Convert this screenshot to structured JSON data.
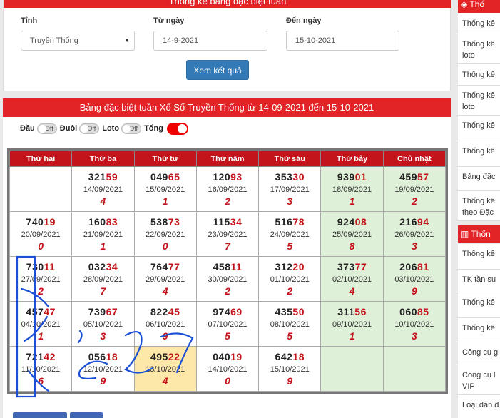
{
  "search": {
    "header": "Thống kê bảng đặc biệt tuần",
    "province_label": "Tỉnh",
    "province_value": "Truyền Thống",
    "from_label": "Từ ngày",
    "from_value": "14-9-2021",
    "to_label": "Đến ngày",
    "to_value": "15-10-2021",
    "submit_label": "Xem kết quả"
  },
  "main": {
    "title": "Bảng đặc biệt tuần Xổ Số Truyền Thống từ 14-09-2021 đến 15-10-2021",
    "toggles": {
      "dau": "Đầu",
      "duoi": "Đuôi",
      "loto": "Loto",
      "tong": "Tổng",
      "off_text": "Off"
    },
    "columns": [
      "Thứ hai",
      "Thứ ba",
      "Thứ tư",
      "Thứ năm",
      "Thứ sáu",
      "Thứ bảy",
      "Chủ nhật"
    ],
    "rows": [
      [
        null,
        {
          "head": "321",
          "tail": "59",
          "date": "14/09/2021",
          "total": "4"
        },
        {
          "head": "049",
          "tail": "65",
          "date": "15/09/2021",
          "total": "1"
        },
        {
          "head": "120",
          "tail": "93",
          "date": "16/09/2021",
          "total": "2"
        },
        {
          "head": "353",
          "tail": "30",
          "date": "17/09/2021",
          "total": "3"
        },
        {
          "head": "939",
          "tail": "01",
          "date": "18/09/2021",
          "total": "1"
        },
        {
          "head": "459",
          "tail": "57",
          "date": "19/09/2021",
          "total": "2"
        }
      ],
      [
        {
          "head": "740",
          "tail": "19",
          "date": "20/09/2021",
          "total": "0"
        },
        {
          "head": "160",
          "tail": "83",
          "date": "21/09/2021",
          "total": "1"
        },
        {
          "head": "538",
          "tail": "73",
          "date": "22/09/2021",
          "total": "0"
        },
        {
          "head": "115",
          "tail": "34",
          "date": "23/09/2021",
          "total": "7"
        },
        {
          "head": "516",
          "tail": "78",
          "date": "24/09/2021",
          "total": "5"
        },
        {
          "head": "924",
          "tail": "08",
          "date": "25/09/2021",
          "total": "8"
        },
        {
          "head": "216",
          "tail": "94",
          "date": "26/09/2021",
          "total": "3"
        }
      ],
      [
        {
          "head": "730",
          "tail": "11",
          "date": "27/09/2021",
          "total": "2"
        },
        {
          "head": "032",
          "tail": "34",
          "date": "28/09/2021",
          "total": "7"
        },
        {
          "head": "764",
          "tail": "77",
          "date": "29/09/2021",
          "total": "4"
        },
        {
          "head": "458",
          "tail": "11",
          "date": "30/09/2021",
          "total": "2"
        },
        {
          "head": "312",
          "tail": "20",
          "date": "01/10/2021",
          "total": "2"
        },
        {
          "head": "373",
          "tail": "77",
          "date": "02/10/2021",
          "total": "4"
        },
        {
          "head": "206",
          "tail": "81",
          "date": "03/10/2021",
          "total": "9"
        }
      ],
      [
        {
          "head": "457",
          "tail": "47",
          "date": "04/10/2021",
          "total": "1"
        },
        {
          "head": "739",
          "tail": "67",
          "date": "05/10/2021",
          "total": "3"
        },
        {
          "head": "822",
          "tail": "45",
          "date": "06/10/2021",
          "total": "9"
        },
        {
          "head": "974",
          "tail": "69",
          "date": "07/10/2021",
          "total": "5"
        },
        {
          "head": "435",
          "tail": "50",
          "date": "08/10/2021",
          "total": "5"
        },
        {
          "head": "311",
          "tail": "56",
          "date": "09/10/2021",
          "total": "1"
        },
        {
          "head": "060",
          "tail": "85",
          "date": "10/10/2021",
          "total": "3"
        }
      ],
      [
        {
          "head": "721",
          "tail": "42",
          "date": "11/10/2021",
          "total": "6"
        },
        {
          "head": "056",
          "tail": "18",
          "date": "12/10/2021",
          "total": "9"
        },
        {
          "head": "495",
          "tail": "22",
          "date": "13/10/2021",
          "total": "4",
          "highlight": true
        },
        {
          "head": "040",
          "tail": "19",
          "date": "14/10/2021",
          "total": "0"
        },
        {
          "head": "642",
          "tail": "18",
          "date": "15/10/2021",
          "total": "9"
        },
        null,
        null
      ]
    ]
  },
  "sidebar": {
    "header1": "Thố",
    "items1": [
      "Thống kê",
      "Thống kê loto",
      "Thống kê",
      "Thống kê loto",
      "Thống kê",
      "Thống kê",
      "Bảng đặc",
      "Thống kê theo Đặc"
    ],
    "header2": "Thốn",
    "items2": [
      "Thống kê",
      "TK tần su",
      "Thống kê",
      "Thống kê",
      "Công cụ g",
      "Công cụ l VIP",
      "Loại dàn đ"
    ]
  },
  "colors": {
    "brand_red": "#e32427",
    "weekend_green": "#dff0d8",
    "highlight_yellow": "#fde8a9",
    "button_blue": "#337ab7",
    "scribble_blue": "#1a4fd6"
  }
}
